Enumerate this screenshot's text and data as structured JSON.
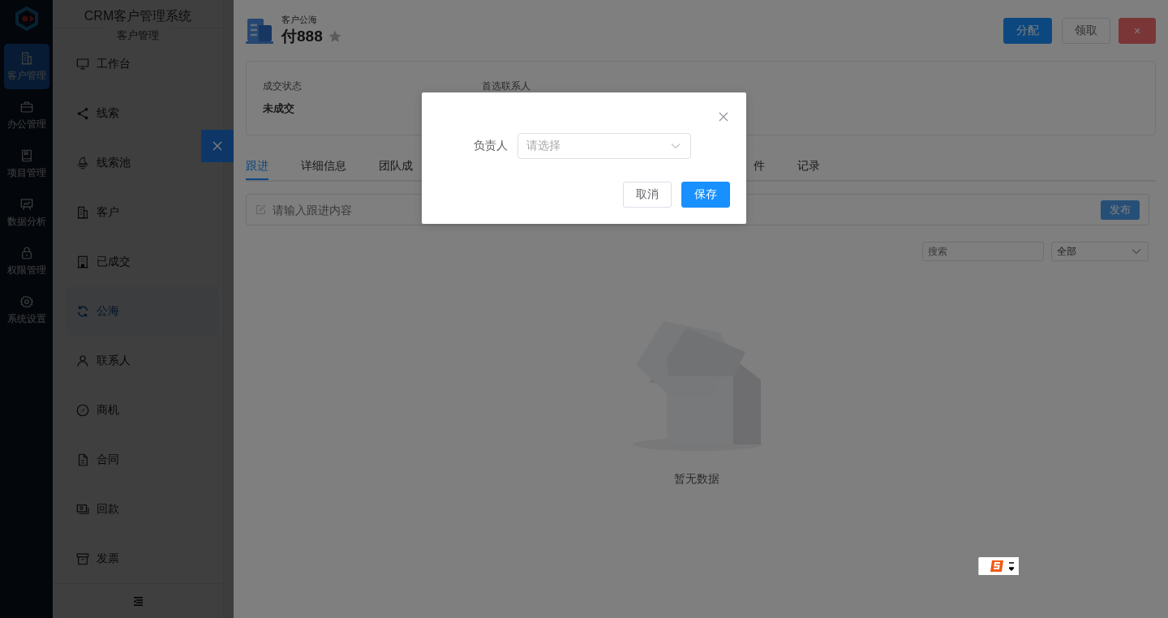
{
  "rail": {
    "items": [
      {
        "label": "客户管理",
        "selected": true
      },
      {
        "label": "办公管理",
        "selected": false
      },
      {
        "label": "项目管理",
        "selected": false
      },
      {
        "label": "数据分析",
        "selected": false
      },
      {
        "label": "权限管理",
        "selected": false
      },
      {
        "label": "系统设置",
        "selected": false
      }
    ]
  },
  "sidebar": {
    "title": "CRM客户管理系统",
    "section": "客户管理",
    "items": [
      {
        "label": "工作台",
        "selected": false
      },
      {
        "label": "线索",
        "selected": false
      },
      {
        "label": "线索池",
        "selected": false
      },
      {
        "label": "客户",
        "selected": false
      },
      {
        "label": "已成交",
        "selected": false
      },
      {
        "label": "公海",
        "selected": true
      },
      {
        "label": "联系人",
        "selected": false
      },
      {
        "label": "商机",
        "selected": false
      },
      {
        "label": "合同",
        "selected": false
      },
      {
        "label": "回款",
        "selected": false
      },
      {
        "label": "发票",
        "selected": false
      }
    ]
  },
  "drawer": {
    "subtitle": "客户公海",
    "title": "付888",
    "starred": false,
    "buttons": [
      {
        "label": "分配",
        "kind": "primary"
      },
      {
        "label": "领取",
        "kind": "default"
      },
      {
        "label": "×",
        "kind": "danger"
      }
    ],
    "info": [
      {
        "label": "成交状态",
        "value": "未成交"
      },
      {
        "label": "首选联系人"
      }
    ],
    "tabs": [
      {
        "label": "跟进",
        "selected": true
      },
      {
        "label": "详细信息",
        "selected": false
      },
      {
        "label": "团队成",
        "selected": false
      },
      {
        "label": "件",
        "selected": false
      },
      {
        "label": "记录",
        "selected": false
      }
    ],
    "composer": {
      "placeholder": "请输入跟进内容",
      "button": "发布"
    },
    "filter": {
      "search_placeholder": "搜索",
      "select_value": "全部"
    },
    "empty_text": "暂无数据"
  },
  "dialog": {
    "field_label": "负责人",
    "placeholder": "请选择",
    "buttons": [
      {
        "label": "取消",
        "kind": "default"
      },
      {
        "label": "保存",
        "kind": "primary"
      }
    ]
  }
}
